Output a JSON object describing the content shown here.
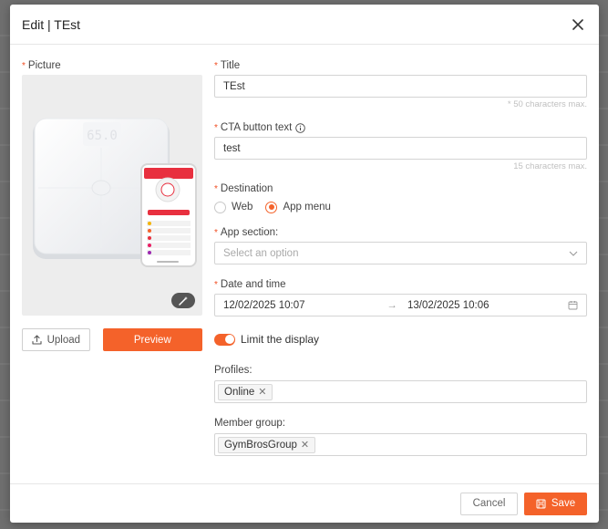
{
  "modal": {
    "title": "Edit | TEst"
  },
  "picture": {
    "label": "Picture",
    "scale_display": "65.0",
    "upload_label": "Upload",
    "preview_label": "Preview"
  },
  "form": {
    "title": {
      "label": "Title",
      "value": "TEst",
      "hint": "* 50 characters max."
    },
    "cta": {
      "label": "CTA button text",
      "value": "test",
      "hint": "15 characters max."
    },
    "destination": {
      "label": "Destination",
      "options": [
        "Web",
        "App menu"
      ],
      "selected": "App menu"
    },
    "app_section": {
      "label": "App section:",
      "placeholder": "Select an option"
    },
    "date_time": {
      "label": "Date and time",
      "start": "12/02/2025 10:07",
      "separator": "→",
      "end": "13/02/2025 10:06"
    },
    "limit_display": {
      "label": "Limit the display",
      "enabled": true
    },
    "profiles": {
      "label": "Profiles:",
      "tags": [
        "Online"
      ]
    },
    "member_group": {
      "label": "Member group:",
      "tags": [
        "GymBrosGroup"
      ]
    }
  },
  "footer": {
    "cancel_label": "Cancel",
    "save_label": "Save"
  },
  "colors": {
    "accent": "#f4622a",
    "required": "#f04e23"
  }
}
